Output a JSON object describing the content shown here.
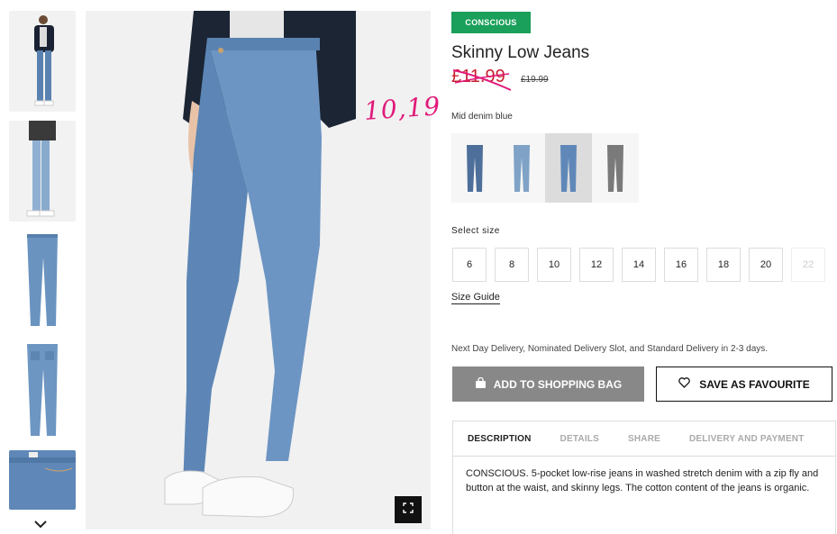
{
  "product": {
    "badge": "CONSCIOUS",
    "title": "Skinny Low Jeans",
    "sale_price": "£11.99",
    "original_price": "£19.99",
    "handwritten_note": "10,19",
    "color_name": "Mid denim blue"
  },
  "swatches": [
    {
      "name": "Mid denim blue dark",
      "color": "#4d6f9a",
      "selected": false
    },
    {
      "name": "Light denim blue",
      "color": "#7fa2c6",
      "selected": false
    },
    {
      "name": "Mid denim blue",
      "color": "#5f88b8",
      "selected": true
    },
    {
      "name": "Grey denim",
      "color": "#7a7a7a",
      "selected": false
    }
  ],
  "sizes": {
    "label": "Select size",
    "options": [
      "6",
      "8",
      "10",
      "12",
      "14",
      "16",
      "18",
      "20",
      "22"
    ],
    "disabled": [
      "22"
    ],
    "guide_label": "Size Guide"
  },
  "delivery": {
    "text": "Next Day Delivery, Nominated Delivery Slot, and Standard Delivery in 2-3 days."
  },
  "actions": {
    "add_to_bag": "ADD TO SHOPPING BAG",
    "save_favourite": "SAVE AS FAVOURITE"
  },
  "tabs": [
    {
      "label": "DESCRIPTION",
      "active": true
    },
    {
      "label": "DETAILS",
      "active": false
    },
    {
      "label": "SHARE",
      "active": false
    },
    {
      "label": "DELIVERY AND PAYMENT",
      "active": false
    }
  ],
  "description": "CONSCIOUS. 5-pocket low-rise jeans in washed stretch denim with a zip fly and button at the waist, and skinny legs. The cotton content of the jeans is organic.",
  "colors": {
    "accent_badge": "#1aa05a",
    "sale": "#c81e2e",
    "note": "#e0197a",
    "button_disabled": "#888888"
  },
  "icons": [
    "chevron-down-icon",
    "fullscreen-icon",
    "shopping-bag-icon",
    "heart-icon"
  ]
}
